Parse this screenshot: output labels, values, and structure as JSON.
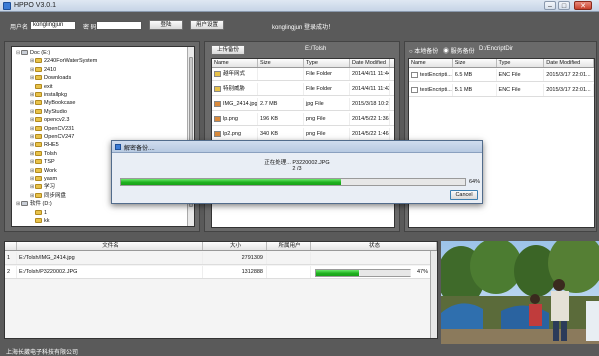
{
  "window": {
    "title": "HPPO  V3.0.1",
    "minimize": "–",
    "maximize": "□",
    "close": "✕"
  },
  "toolbar": {
    "username_label": "用户名",
    "username_value": "konglingjun",
    "password_label": "密  码",
    "login_button": "登陆",
    "settings_button": "用户设置",
    "welcome": "konglingjun  登录成功！"
  },
  "tree": {
    "items": [
      {
        "label": "Doc (E:)",
        "level": 0,
        "exp": "⊟"
      },
      {
        "label": "2240ForWaterSystem",
        "level": 1,
        "exp": "⊞"
      },
      {
        "label": "2410",
        "level": 1,
        "exp": "⊞"
      },
      {
        "label": "Downloads",
        "level": 1,
        "exp": "⊞"
      },
      {
        "label": "exit",
        "level": 1,
        "exp": ""
      },
      {
        "label": "installpkg",
        "level": 1,
        "exp": "⊞"
      },
      {
        "label": "MyBookcase",
        "level": 1,
        "exp": "⊞"
      },
      {
        "label": "MyStudio",
        "level": 1,
        "exp": "⊞"
      },
      {
        "label": "opencv2.3",
        "level": 1,
        "exp": "⊞"
      },
      {
        "label": "OpenCV231",
        "level": 1,
        "exp": "⊞"
      },
      {
        "label": "OpenCV247",
        "level": 1,
        "exp": "⊞"
      },
      {
        "label": "RHE5",
        "level": 1,
        "exp": "⊞"
      },
      {
        "label": "Tolsh",
        "level": 1,
        "exp": "⊞"
      },
      {
        "label": "TSP",
        "level": 1,
        "exp": "⊞"
      },
      {
        "label": "Work",
        "level": 1,
        "exp": "⊞"
      },
      {
        "label": "yasm",
        "level": 1,
        "exp": "⊞"
      },
      {
        "label": "学习",
        "level": 1,
        "exp": "⊞"
      },
      {
        "label": "同步网盘",
        "level": 1,
        "exp": "⊞"
      },
      {
        "label": "软件 (D:)",
        "level": 0,
        "exp": "⊞"
      },
      {
        "label": "1",
        "level": 1,
        "exp": ""
      },
      {
        "label": "kk",
        "level": 1,
        "exp": ""
      }
    ]
  },
  "local": {
    "upload_button": "上传备份",
    "path": "E:/Tolsh",
    "columns": [
      "Name",
      "Size",
      "Type",
      "Date Modified"
    ],
    "rows": [
      {
        "name": "越年网式",
        "size": "",
        "type": "File Folder",
        "date": "2014/4/11 11:44...",
        "icon": "folder"
      },
      {
        "name": "特别威胁",
        "size": "",
        "type": "File Folder",
        "date": "2014/4/11 11:43...",
        "icon": "folder"
      },
      {
        "name": "IMG_2414.jpg",
        "size": "2.7 MB",
        "type": "jpg File",
        "date": "2015/3/18 10:21...",
        "icon": "image"
      },
      {
        "name": "lp.png",
        "size": "196 KB",
        "type": "png File",
        "date": "2014/5/22 1:36:0...",
        "icon": "image"
      },
      {
        "name": "lp2.png",
        "size": "340 KB",
        "type": "png File",
        "date": "2014/5/22 1:46:...",
        "icon": "image"
      },
      {
        "name": "",
        "size": "",
        "type": "",
        "date": "",
        "icon": "image"
      }
    ]
  },
  "remote": {
    "radio_local": "本地备份",
    "radio_remote": "服务备份",
    "path": "D:/EncriptDir",
    "columns": [
      "Name",
      "Size",
      "Type",
      "Date Modified"
    ],
    "rows": [
      {
        "name": "testEncripti...",
        "size": "6.5 MB",
        "type": "ENC File",
        "date": "2015/3/17 22:01..."
      },
      {
        "name": "testEncripti...",
        "size": "5.1 MB",
        "type": "ENC File",
        "date": "2015/3/17 22:01..."
      }
    ]
  },
  "dialog": {
    "title": "解密备份....",
    "status_line": "正在处理... P3220002.JPG",
    "count": "2 /3",
    "percent_label": "64%",
    "progress": 0.64,
    "cancel_button": "Cancel"
  },
  "queue": {
    "columns": [
      "文件名",
      "大小",
      "所属用户",
      "状态"
    ],
    "rows": [
      {
        "idx": "1",
        "name": "E:/Tolsh/IMG_2414.jpg",
        "size": "2791309",
        "user": "",
        "progress": null,
        "percent": ""
      },
      {
        "idx": "2",
        "name": "E:/Tolsh/P3220002.JPG",
        "size": "1312888",
        "user": "",
        "progress": 0.47,
        "percent": "47%"
      }
    ]
  },
  "status": {
    "company": "上海长葳电子科技有限公司"
  },
  "colors": {
    "progress_green": "#1fb11f",
    "accent": "#3a7bd5"
  }
}
